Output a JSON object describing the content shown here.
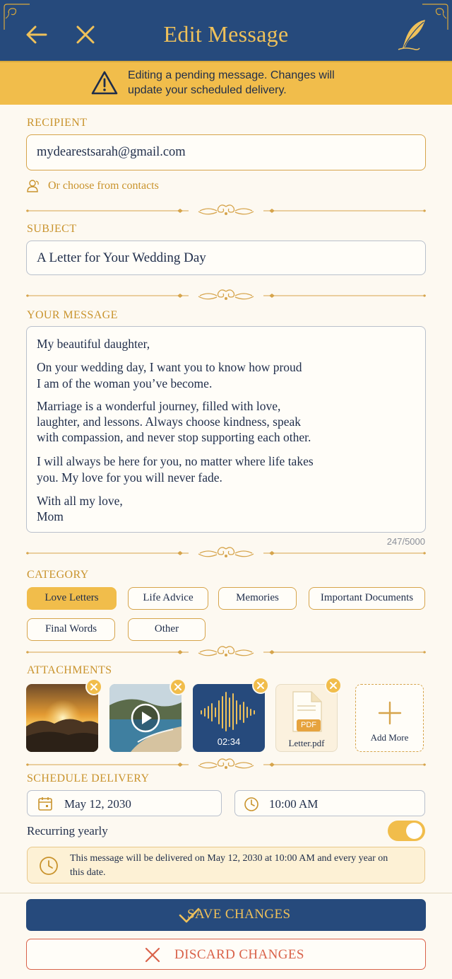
{
  "header": {
    "title": "Edit Message",
    "back_icon": "arrow-left-icon",
    "close_icon": "close-icon",
    "quill_icon": "quill-pen-icon"
  },
  "banner": {
    "text": "Editing a pending message. Changes will update your scheduled delivery.",
    "icon": "warning-icon"
  },
  "recipient": {
    "label": "RECIPIENT",
    "value": "mydearestsarah@gmail.com",
    "contacts_link": "Or choose from contacts"
  },
  "subject": {
    "label": "SUBJECT",
    "value": "A Letter for Your Wedding Day"
  },
  "message": {
    "label": "YOUR MESSAGE",
    "lines": [
      "My beautiful daughter,",
      "On your wedding day, I want you to know how proud",
      "I am of the woman you’ve become.",
      "Marriage is a wonderful journey, filled with love,",
      "laughter, and lessons. Always choose kindness, speak",
      "with compassion, and never stop supporting each other.",
      "I will always be here for you, no matter where life takes",
      "you. My love for you will never fade.",
      "With all my love,",
      "Mom"
    ],
    "counter": "247/5000"
  },
  "category": {
    "label": "CATEGORY",
    "chips": [
      "Love Letters",
      "Life Advice",
      "Memories",
      "Important Documents",
      "Final Words",
      "Other"
    ],
    "selected": "Love Letters"
  },
  "attachments": {
    "label": "ATTACHMENTS",
    "audio_duration": "02:34",
    "pdf_badge": "PDF",
    "pdf_name": "Letter.pdf",
    "add_more": "Add More"
  },
  "schedule": {
    "label": "SCHEDULE DELIVERY",
    "date": "May 12, 2030",
    "time": "10:00 AM",
    "recurring_label": "Recurring yearly",
    "recurring_on": true,
    "info": "This message will be delivered on May 12, 2030 at 10:00 AM and every year on this date."
  },
  "actions": {
    "save": "SAVE CHANGES",
    "discard": "DISCARD CHANGES"
  },
  "colors": {
    "navy": "#264a7c",
    "gold": "#f1bd4b",
    "label_gold": "#c9932c",
    "danger": "#d9624a",
    "background": "#fdf9f1"
  }
}
